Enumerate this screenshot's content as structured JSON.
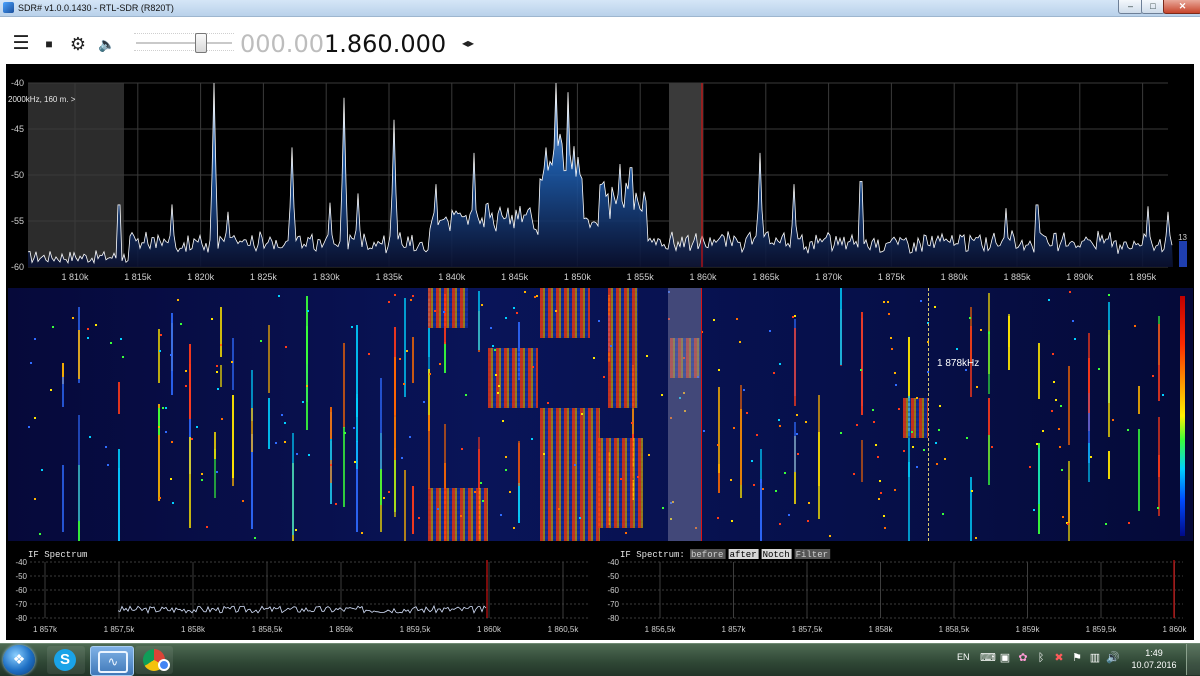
{
  "window": {
    "title": "SDR# v1.0.0.1430 - RTL-SDR (R820T)",
    "buttons": {
      "minimize": "–",
      "maximize": "□",
      "close": "✕"
    }
  },
  "toolbar": {
    "icons": [
      "menu-icon",
      "stop-icon",
      "gear-icon",
      "volume-icon",
      "tune-arrows-icon"
    ],
    "volume_level": 0.66,
    "frequency_prefix": "000.00",
    "frequency_main": "1.860.000",
    "arrows_glyph": "◂▸"
  },
  "spectrum": {
    "band_label": "2000kHz, 160 m. >",
    "y_ticks": [
      "-40",
      "-45",
      "-50",
      "-55",
      "-60"
    ],
    "x_ticks": [
      "1 810k",
      "1 815k",
      "1 820k",
      "1 825k",
      "1 830k",
      "1 835k",
      "1 840k",
      "1 845k",
      "1 850k",
      "1 855k",
      "1 860k",
      "1 865k",
      "1 870k",
      "1 875k",
      "1 880k",
      "1 885k",
      "1 890k",
      "1 895k"
    ],
    "level_readout": "13",
    "colors": {
      "background": "#000000",
      "trace": "#ffffff",
      "fill": "#1f5fb0",
      "filter_band": "#3a3a3a",
      "tuned_line": "#cc1111"
    }
  },
  "waterfall": {
    "cursor_label": "1 878kHz"
  },
  "if_spectrum_left": {
    "title": "IF Spectrum",
    "y_ticks": [
      "-40",
      "-50",
      "-60",
      "-70",
      "-80"
    ],
    "x_ticks": [
      "1 857k",
      "1 857,5k",
      "1 858k",
      "1 858,5k",
      "1 859k",
      "1 859,5k",
      "1 860k",
      "1 860,5k"
    ]
  },
  "if_spectrum_right": {
    "title": "IF Spectrum:",
    "buttons": [
      "before",
      "after",
      "Notch",
      "Filter"
    ],
    "y_ticks": [
      "-40",
      "-50",
      "-60",
      "-70",
      "-80"
    ],
    "x_ticks": [
      "1 856,5k",
      "1 857k",
      "1 857,5k",
      "1 858k",
      "1 858,5k",
      "1 859k",
      "1 859,5k",
      "1 860k"
    ]
  },
  "taskbar": {
    "apps": [
      "start-button",
      "skype-icon",
      "sdr-icon",
      "chrome-icon"
    ],
    "skype_letter": "S",
    "language": "EN",
    "time": "1:49",
    "date": "10.07.2016"
  }
}
